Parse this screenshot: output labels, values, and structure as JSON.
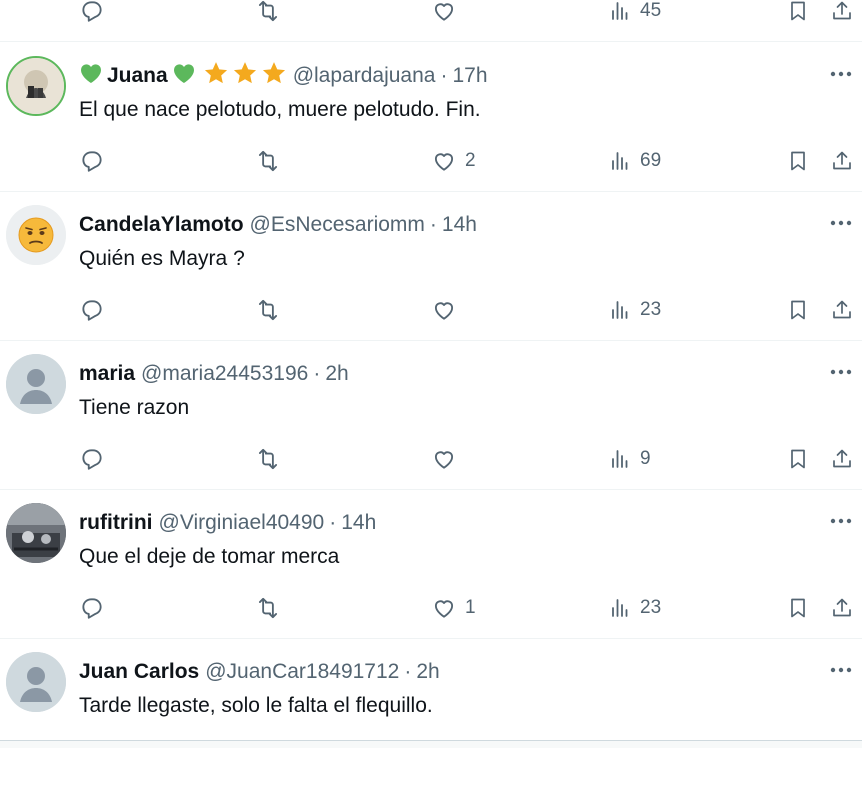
{
  "top_partial": {
    "views": "45"
  },
  "tweets": [
    {
      "name": "Juana",
      "handle": "@lapardajuana",
      "time": "17h",
      "text": "El que nace pelotudo, muere pelotudo. Fin.",
      "replies": "",
      "retweets": "",
      "likes": "2",
      "views": "69",
      "avatar": "photo"
    },
    {
      "name": "CandelaYlamoto",
      "handle": "@EsNecesariomm",
      "time": "14h",
      "text": "Quién es Mayra ?",
      "replies": "",
      "retweets": "",
      "likes": "",
      "views": "23",
      "avatar": "emoji"
    },
    {
      "name": "maria",
      "handle": "@maria24453196",
      "time": "2h",
      "text": "Tiene razon",
      "replies": "",
      "retweets": "",
      "likes": "",
      "views": "9",
      "avatar": "default"
    },
    {
      "name": "rufitrini",
      "handle": "@Virginiael40490",
      "time": "14h",
      "text": "Que el deje de tomar merca",
      "replies": "",
      "retweets": "",
      "likes": "1",
      "views": "23",
      "avatar": "photo-dark"
    },
    {
      "name": "Juan Carlos",
      "handle": "@JuanCar18491712",
      "time": "2h",
      "text": "Tarde llegaste, solo le falta el flequillo.",
      "replies": "",
      "retweets": "",
      "likes": "",
      "views": "",
      "avatar": "default"
    }
  ],
  "colors": {
    "muted": "#536471",
    "text": "#0f1419",
    "divider": "#eff3f4",
    "star": "#f4a91e",
    "green_heart": "#5cb85c"
  },
  "icons": [
    "reply-icon",
    "retweet-icon",
    "like-icon",
    "views-icon",
    "bookmark-icon",
    "share-icon",
    "more-icon",
    "star-icon",
    "green-heart-icon"
  ]
}
